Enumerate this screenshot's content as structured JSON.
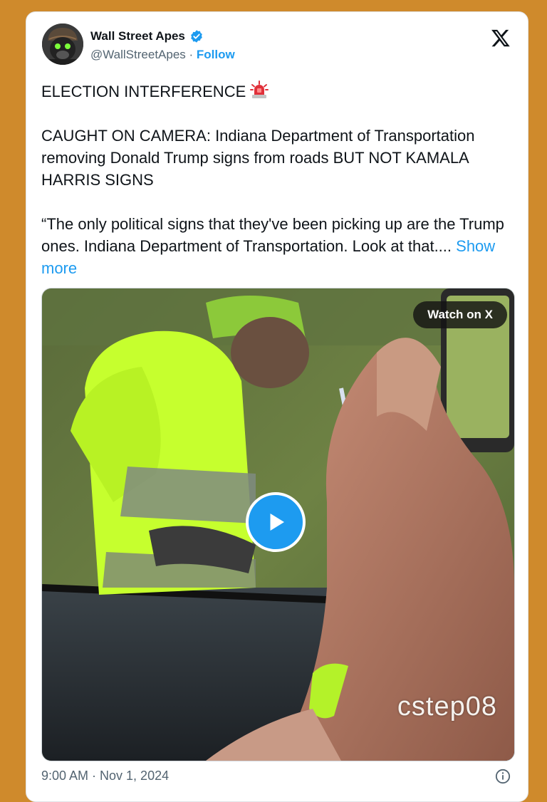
{
  "author": {
    "name": "Wall Street Apes",
    "handle": "@WallStreetApes",
    "separator": " · ",
    "follow_label": "Follow",
    "verified_color": "#1d9bf0"
  },
  "tweet": {
    "headline": "ELECTION INTERFERENCE",
    "headline_emoji": "police-siren-icon",
    "paragraph2": "CAUGHT ON CAMERA: Indiana Department of Transportation removing Donald Trump signs from roads BUT NOT KAMALA HARRIS SIGNS",
    "paragraph3": "“The only political signs that they've been picking up are the Trump ones. Indiana Department of Transportation. Look at that....",
    "show_more": " Show more"
  },
  "media": {
    "watch_label": "Watch on X",
    "watermark": "cstep08",
    "play_icon": "play-icon"
  },
  "footer": {
    "timestamp": "9:00 AM · Nov 1, 2024",
    "info_icon": "info-icon"
  },
  "colors": {
    "page_bg": "#cf8a2c",
    "accent": "#1d9bf0",
    "text": "#0f1419",
    "muted": "#536471"
  }
}
